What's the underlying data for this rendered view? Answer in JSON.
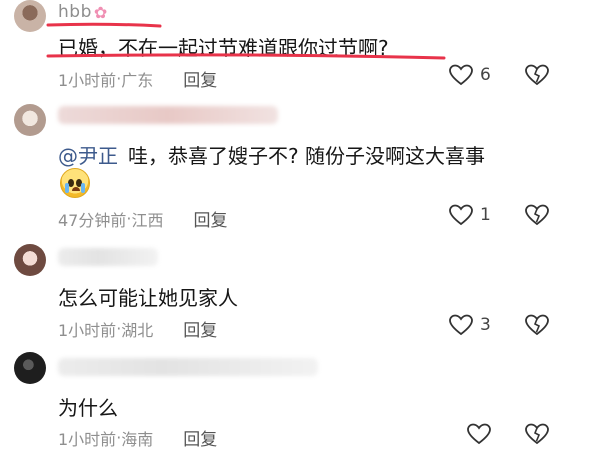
{
  "comments": [
    {
      "username": "hbb",
      "text": "已婚，不在一起过节难道跟你过节啊?",
      "time": "1小时前",
      "location": "广东",
      "reply_label": "回复",
      "like_count": "6",
      "highlighted": true
    },
    {
      "mention": "@尹正",
      "text": "哇，恭喜了嫂子不? 随份子没啊这大喜事",
      "emoji": "crying-face",
      "time": "47分钟前",
      "location": "江西",
      "reply_label": "回复",
      "like_count": "1"
    },
    {
      "text": "怎么可能让她见家人",
      "time": "1小时前",
      "location": "湖北",
      "reply_label": "回复",
      "like_count": "3"
    },
    {
      "text": "为什么",
      "time": "1小时前",
      "location": "海南",
      "reply_label": "回复",
      "like_count": ""
    }
  ],
  "separator": " · ",
  "icons": {
    "like": "heart-outline-icon",
    "dislike": "broken-heart-icon",
    "decoration": "flower-icon"
  },
  "colors": {
    "highlight_underline": "#e8334a",
    "mention": "#3d5a8c"
  }
}
